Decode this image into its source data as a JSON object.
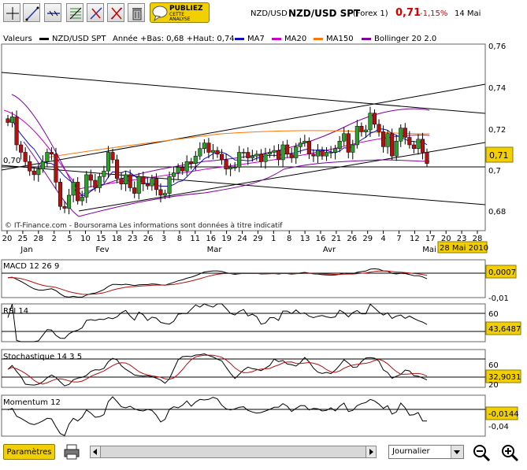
{
  "toolbar": {
    "tools": [
      "crosshair-tool",
      "line-tool",
      "horizontal-line-tool",
      "fibonacci-tool",
      "erase-tool",
      "delete-tool",
      "trash-tool"
    ],
    "publish": {
      "line1": "PUBLIEZ",
      "line2": "CETTE ANALYSE"
    }
  },
  "header": {
    "symbol": "NZD/USD",
    "title": "NZD/USD SPT",
    "market": "(Forex 1)",
    "price": "0,71",
    "change": "-1,15%",
    "date": "14 Mai"
  },
  "legend": {
    "valeurs": "Valeurs",
    "instrument": "NZD/USD SPT",
    "year_range": "Année +Bas: 0,68 +Haut: 0,74",
    "items": [
      {
        "label": "MA7",
        "color": "#1010c0"
      },
      {
        "label": "MA20",
        "color": "#cc00cc"
      },
      {
        "label": "MA150",
        "color": "#ff7700"
      },
      {
        "label": "Bollinger 20 2.0",
        "color": "#8000a0"
      }
    ]
  },
  "colors": {
    "up": "#2e9d2e",
    "down": "#b31010",
    "price_label_bg": "#f2d000"
  },
  "chart_data": [
    {
      "type": "candlestick",
      "title": "NZD/USD SPT",
      "ylim": [
        0.67,
        0.77
      ],
      "yticks": [
        "0,76",
        "0,74",
        "0,72",
        "0,7",
        "0,68"
      ],
      "left_label": "0,70",
      "last_label": "0,71",
      "date_ticks": [
        "20",
        "25",
        "28",
        "2",
        "5",
        "10",
        "15",
        "18",
        "23",
        "26",
        "3",
        "8",
        "11",
        "16",
        "19",
        "24",
        "29",
        "1",
        "8",
        "13",
        "16",
        "21",
        "26",
        "29",
        "4",
        "7",
        "12",
        "17",
        "20",
        "23",
        "28"
      ],
      "month_labels": [
        "Jan",
        "Fev",
        "Mar",
        "Avr",
        "Mai"
      ],
      "cursor_date": "28 Mai 2010",
      "watermark": "© IT-Finance.com - Boursorama Les informations sont données à titre indicatif",
      "closes": [
        0.728,
        0.731,
        0.716,
        0.712,
        0.707,
        0.702,
        0.7,
        0.703,
        0.707,
        0.712,
        0.711,
        0.696,
        0.683,
        0.682,
        0.689,
        0.696,
        0.686,
        0.688,
        0.7,
        0.697,
        0.693,
        0.699,
        0.702,
        0.712,
        0.708,
        0.698,
        0.695,
        0.7,
        0.693,
        0.69,
        0.699,
        0.695,
        0.694,
        0.698,
        0.692,
        0.689,
        0.69,
        0.699,
        0.701,
        0.704,
        0.702,
        0.707,
        0.706,
        0.71,
        0.714,
        0.717,
        0.712,
        0.713,
        0.711,
        0.708,
        0.703,
        0.704,
        0.704,
        0.712,
        0.712,
        0.709,
        0.71,
        0.711,
        0.707,
        0.711,
        0.712,
        0.713,
        0.708,
        0.716,
        0.711,
        0.709,
        0.715,
        0.717,
        0.718,
        0.711,
        0.71,
        0.713,
        0.71,
        0.712,
        0.712,
        0.714,
        0.718,
        0.722,
        0.712,
        0.716,
        0.726,
        0.723,
        0.724,
        0.733,
        0.727,
        0.723,
        0.715,
        0.722,
        0.71,
        0.718,
        0.725,
        0.72,
        0.716,
        0.714,
        0.719,
        0.712,
        0.706
      ]
    },
    {
      "type": "line",
      "title": "MACD 12 26 9",
      "ylim": [
        -0.01,
        0.009
      ],
      "yticks": [
        "-0,01"
      ],
      "last_label": "0,0007",
      "series": [
        {
          "name": "MACD",
          "color": "#000000"
        },
        {
          "name": "Signal",
          "color": "#b31010"
        }
      ]
    },
    {
      "type": "line",
      "title": "RSI 14",
      "ylim": [
        15,
        70
      ],
      "yticks": [
        "60"
      ],
      "last_label": "43,6487",
      "series": [
        {
          "name": "RSI",
          "color": "#000000"
        }
      ]
    },
    {
      "type": "line",
      "title": "Stochastique 14 3 5",
      "ylim": [
        0,
        105
      ],
      "yticks": [
        "60",
        "20"
      ],
      "last_label": "32,9031",
      "series": [
        {
          "name": "%K",
          "color": "#000000"
        },
        {
          "name": "%D",
          "color": "#b31010"
        }
      ]
    },
    {
      "type": "line",
      "title": "Momentum 12",
      "ylim": [
        -0.05,
        0.028
      ],
      "yticks": [
        "-0,04"
      ],
      "last_label": "-0,0144",
      "series": [
        {
          "name": "Momentum",
          "color": "#000000"
        }
      ]
    }
  ],
  "bottom": {
    "params": "Paramètres",
    "period": "Journalier"
  }
}
